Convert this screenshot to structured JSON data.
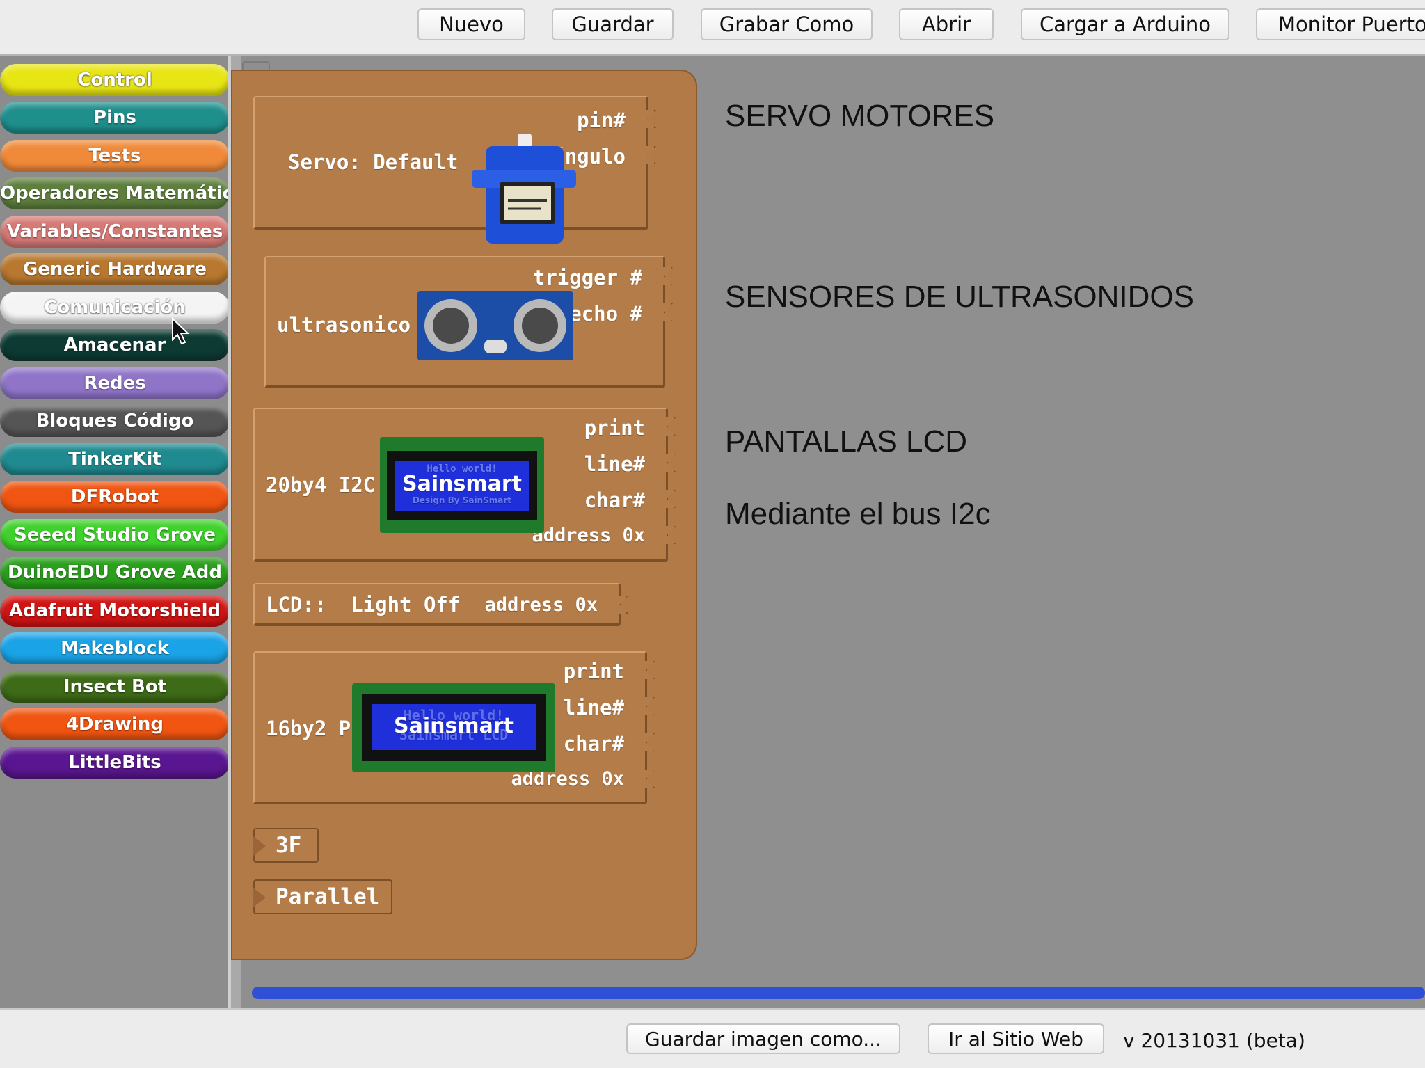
{
  "toolbar": {
    "buttons": [
      "Nuevo",
      "Guardar",
      "Grabar Como",
      "Abrir",
      "Cargar a Arduino",
      "Monitor Puerto"
    ]
  },
  "palette": {
    "categories": [
      {
        "label": "Control",
        "color": "#e8e514",
        "text_color": "#ffffff"
      },
      {
        "label": "Pins",
        "color": "#1f8f8c"
      },
      {
        "label": "Tests",
        "color": "#f08a3a"
      },
      {
        "label": "Operadores Matemáticos",
        "color": "#5e7f3e"
      },
      {
        "label": "Variables/Constantes",
        "color": "#d77a76"
      },
      {
        "label": "Generic Hardware",
        "color": "#b8782f"
      },
      {
        "label": "Comunicación",
        "color": "#f2f2f2"
      },
      {
        "label": "Amacenar",
        "color": "#0e3a34"
      },
      {
        "label": "Redes",
        "color": "#8f74c8"
      },
      {
        "label": "Bloques Código",
        "color": "#555555"
      },
      {
        "label": "TinkerKit",
        "color": "#1f8a8f"
      },
      {
        "label": "DFRobot",
        "color": "#f05512"
      },
      {
        "label": "Seeed Studio Grove",
        "color": "#3fd12c"
      },
      {
        "label": "DuinoEDU Grove Add",
        "color": "#2aa01c"
      },
      {
        "label": "Adafruit Motorshield",
        "color": "#d11414"
      },
      {
        "label": "Makeblock",
        "color": "#1aa3e6"
      },
      {
        "label": "Insect Bot",
        "color": "#3e6b17"
      },
      {
        "label": "4Drawing",
        "color": "#f05512"
      },
      {
        "label": "LittleBits",
        "color": "#5a1690"
      }
    ]
  },
  "blocks": {
    "servo": {
      "title": "Servo: Default",
      "sockets": [
        "pin#",
        "ángulo"
      ]
    },
    "ultrasonic": {
      "title": "ultrasonico",
      "sockets": [
        "trigger #",
        "echo #"
      ]
    },
    "lcd20": {
      "title": "20by4 I2C",
      "screen": "Sainsmart",
      "screen_sub": "Hello world!",
      "screen_sub2": "Design By SainSmart",
      "sockets": [
        "print",
        "line#",
        "char#",
        "address 0x"
      ]
    },
    "lcdoff": {
      "title": "LCD::  Light Off",
      "socket": "address 0x"
    },
    "lcd16": {
      "title": "16by2 PLL",
      "screen": "Sainsmart",
      "screen_sub": "Hello world!",
      "screen_sub2": "Sainsmart LCD",
      "sockets": [
        "print",
        "line#",
        "char#",
        "address 0x"
      ]
    },
    "small": [
      "3F",
      "Parallel"
    ]
  },
  "canvas": {
    "notes": [
      "SERVO MOTORES",
      "SENSORES DE ULTRASONIDOS",
      "PANTALLAS LCD",
      "Mediante el bus I2c"
    ]
  },
  "bottom": {
    "buttons": [
      "Guardar imagen como...",
      "Ir al Sitio Web"
    ],
    "version": "v 20131031 (beta)"
  },
  "colors": {
    "drawer": "#b17a47",
    "canvas": "#8f8f8f",
    "scrollbar": "#2f4fd6"
  }
}
